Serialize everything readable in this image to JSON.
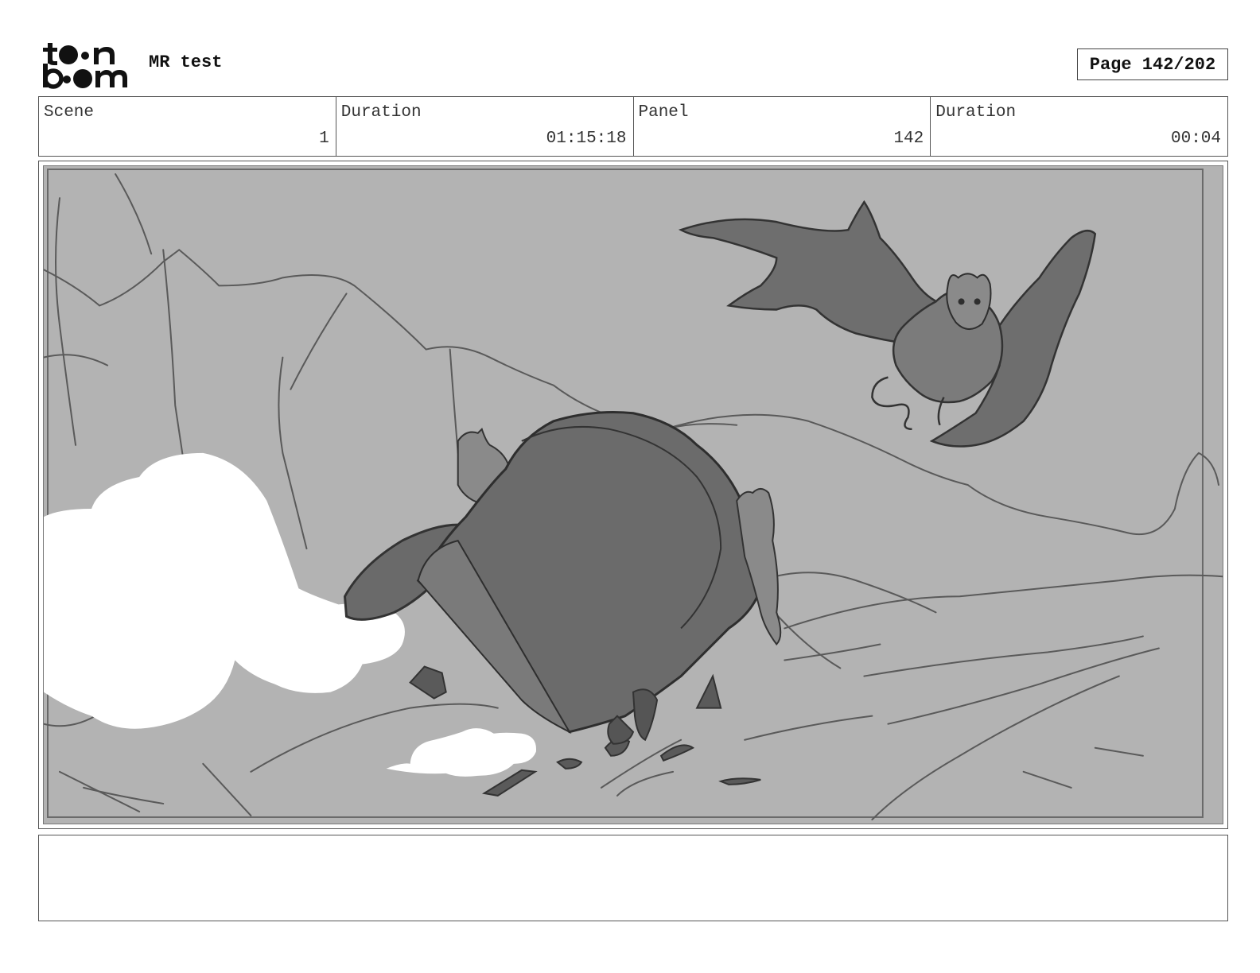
{
  "header": {
    "logo_top": "toon",
    "logo_bottom": "boom",
    "project_title": "MR test",
    "page_indicator": "Page 142/202"
  },
  "info": [
    {
      "label": "Scene",
      "value": "1"
    },
    {
      "label": "Duration",
      "value": "01:15:18"
    },
    {
      "label": "Panel",
      "value": "142"
    },
    {
      "label": "Duration",
      "value": "00:04"
    }
  ],
  "panel": {
    "image": "storyboard sketch"
  },
  "notes": {
    "text": ""
  },
  "colors": {
    "panel_background": "#b3b3b3",
    "shadow_fill": "#6b6b6b",
    "dust_cloud": "#ffffff",
    "line": "#404040"
  }
}
